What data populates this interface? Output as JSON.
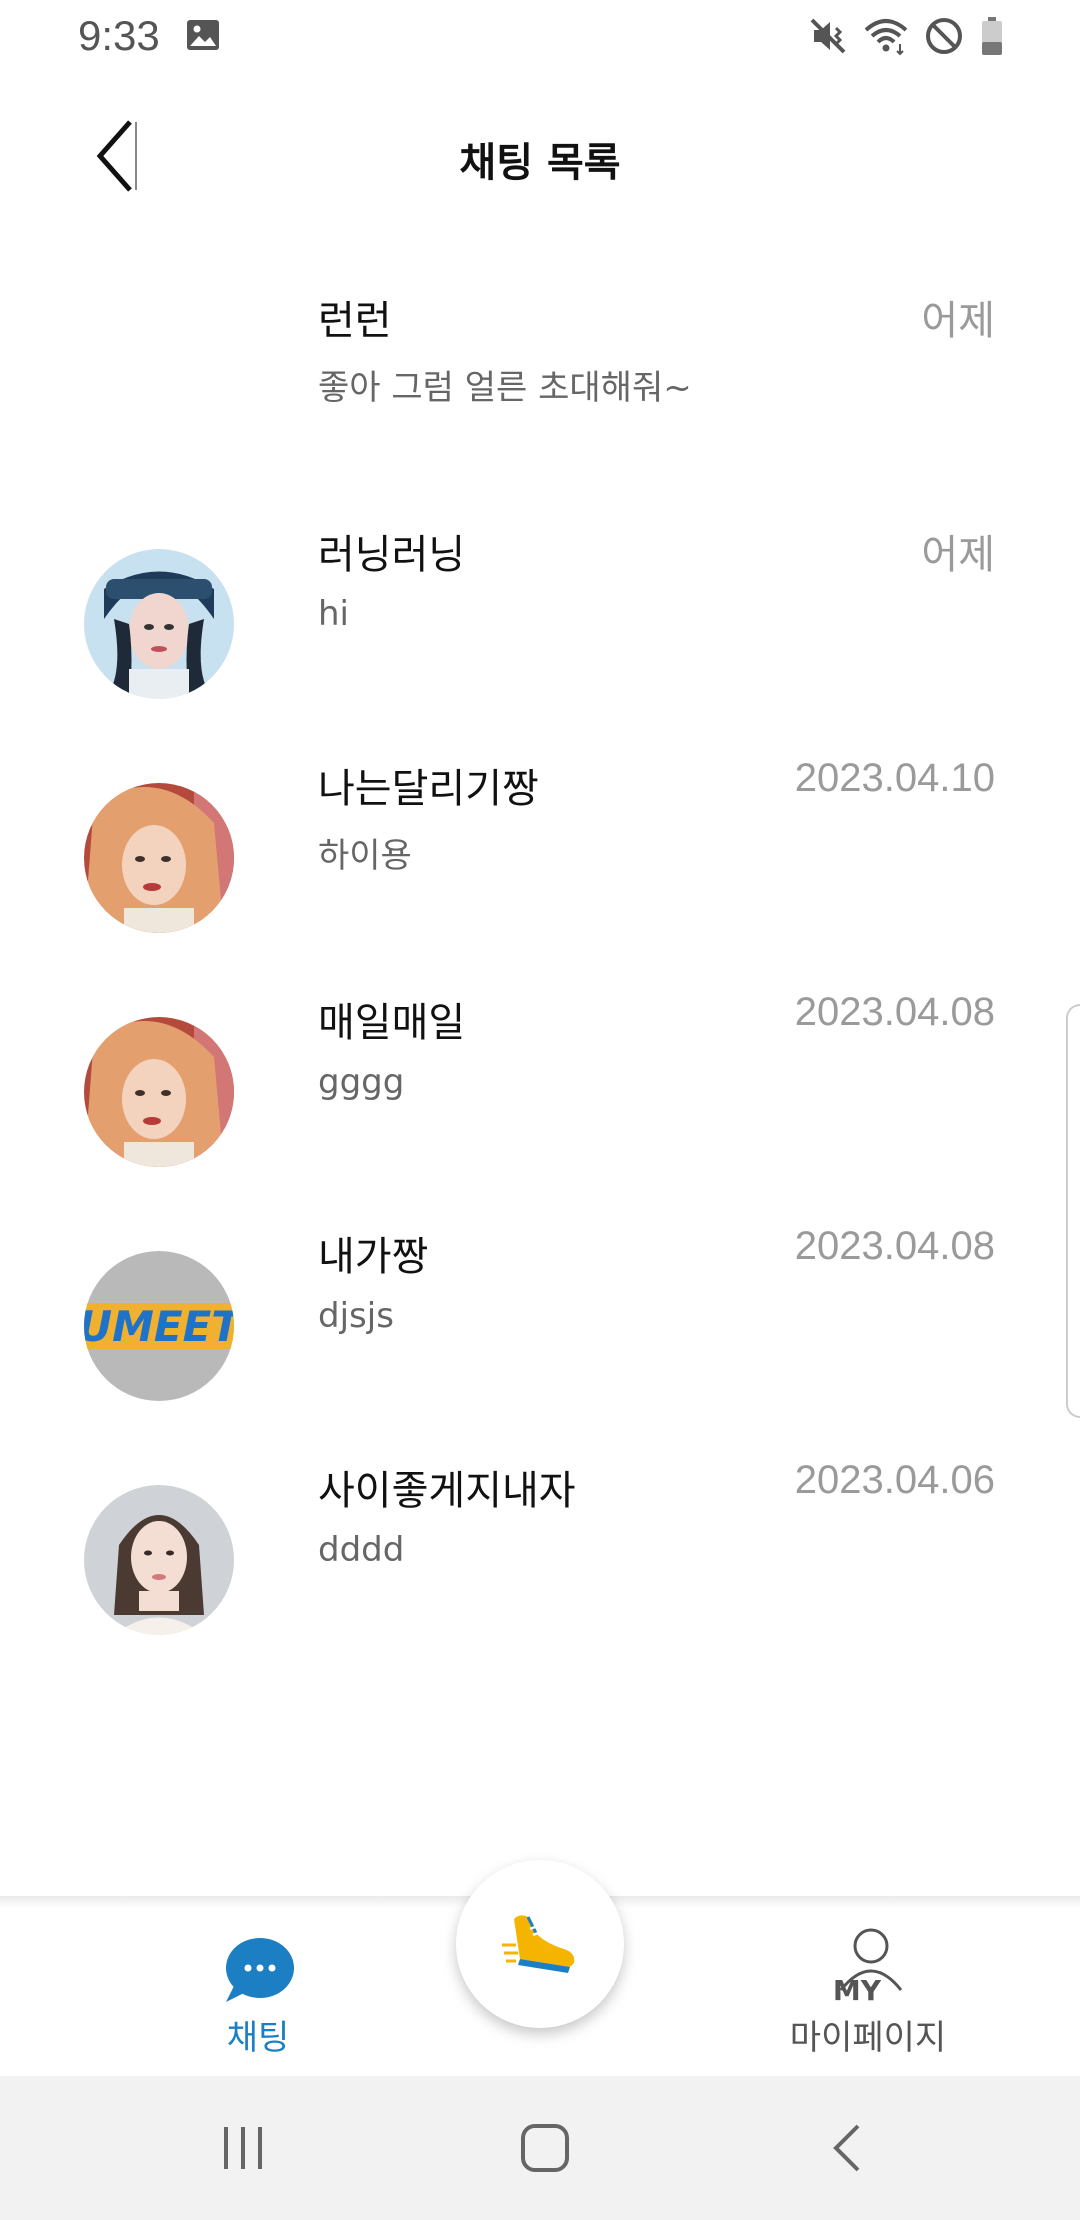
{
  "status_bar": {
    "time": "9:33",
    "icons": [
      "gallery-icon",
      "mute-icon",
      "wifi-icon",
      "do-not-disturb-icon",
      "battery-icon"
    ]
  },
  "header": {
    "title": "채팅 목록",
    "back_icon": "back-chevron-icon"
  },
  "chats": [
    {
      "name": "런런",
      "message": "좋아 그럼 얼른 초대해줘~",
      "time": "어제",
      "avatar": "none"
    },
    {
      "name": "러닝러닝",
      "message": "hi",
      "time": "어제",
      "avatar": "photo-cap-woman"
    },
    {
      "name": "나는달리기짱",
      "message": "하이용",
      "time": "2023.04.10",
      "avatar": "photo-orange-hair-woman"
    },
    {
      "name": "매일매일",
      "message": "gggg",
      "time": "2023.04.08",
      "avatar": "photo-orange-hair-woman"
    },
    {
      "name": "내가짱",
      "message": "djsjs",
      "time": "2023.04.08",
      "avatar": "logo-umeet"
    },
    {
      "name": "사이좋게지내자",
      "message": "dddd",
      "time": "2023.04.06",
      "avatar": "photo-woman-portrait"
    }
  ],
  "avatar_logo_text": "UMEET",
  "bottom_nav": {
    "chat": {
      "label": "채팅",
      "icon": "chat-bubble-icon"
    },
    "center": {
      "icon": "running-shoe-icon"
    },
    "my": {
      "label": "마이페이지",
      "icon": "my-person-icon",
      "icon_text": "MY"
    }
  },
  "colors": {
    "accent": "#1c7fc4",
    "time_gray": "#9a9a9a",
    "message_gray": "#666666",
    "shoe_yellow": "#f5b400"
  },
  "system_nav": [
    "recent-apps-icon",
    "home-icon",
    "back-icon"
  ]
}
